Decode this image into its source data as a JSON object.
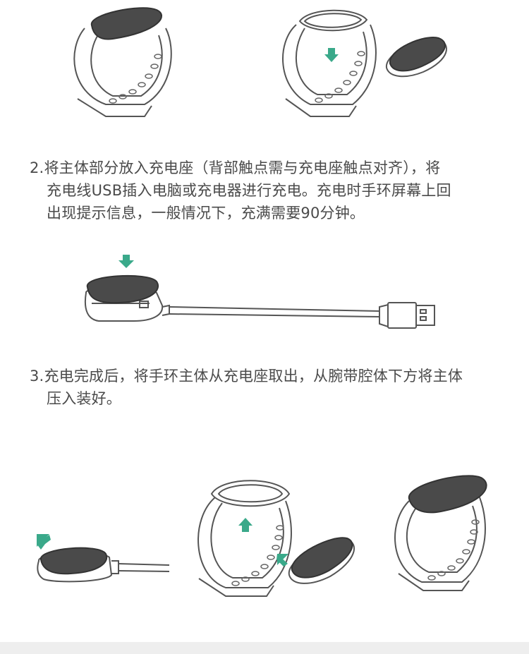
{
  "steps": [
    {
      "number": "2.",
      "lines": [
        "将主体部分放入充电座（背部触点需与充电座触点对齐），将",
        "充电线USB插入电脑或充电器进行充电。充电时手环屏幕上回",
        "出现提示信息，一般情况下，充满需要90分钟。"
      ]
    },
    {
      "number": "3.",
      "lines": [
        "充电完成后，将手环主体从充电座取出，从腕带腔体下方将主体",
        "压入装好。"
      ]
    }
  ],
  "colors": {
    "text": "#4a4a4a",
    "arrow": "#3aa98a",
    "line": "#555555",
    "capsule": "#4a4a4a",
    "footer": "#eeeeee"
  },
  "icons": [
    "band-icon",
    "capsule-icon",
    "charger-cable-icon",
    "usb-plug-icon",
    "down-arrow-icon",
    "up-arrow-icon",
    "diagonal-arrow-icon"
  ]
}
